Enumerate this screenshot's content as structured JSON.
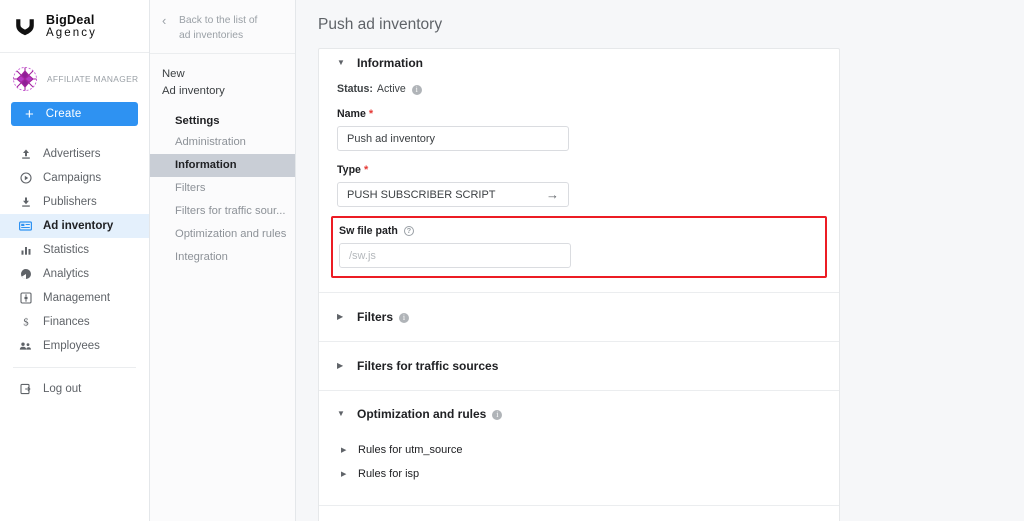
{
  "brand": {
    "name_line1": "BigDeal",
    "name_line2": "Agency",
    "logo_icon": "shield-v-logo"
  },
  "account": {
    "label": "AFFILIATE MANAGER",
    "logo_icon": "affiliate-manager-snowflake-logo"
  },
  "create_button": {
    "label": "Create",
    "icon": "plus-icon",
    "color": "#2e92f2"
  },
  "sidebar": {
    "items": [
      {
        "label": "Advertisers",
        "icon": "upload-arrow-icon",
        "active": false
      },
      {
        "label": "Campaigns",
        "icon": "play-circle-icon",
        "active": false
      },
      {
        "label": "Publishers",
        "icon": "download-arrow-icon",
        "active": false
      },
      {
        "label": "Ad inventory",
        "icon": "ad-banner-icon",
        "active": true
      },
      {
        "label": "Statistics",
        "icon": "bar-chart-icon",
        "active": false
      },
      {
        "label": "Analytics",
        "icon": "pie-chart-icon",
        "active": false
      },
      {
        "label": "Management",
        "icon": "settings-square-icon",
        "active": false
      },
      {
        "label": "Finances",
        "icon": "dollar-icon",
        "active": false
      },
      {
        "label": "Employees",
        "icon": "people-icon",
        "active": false
      }
    ],
    "logout": {
      "label": "Log out",
      "icon": "logout-icon"
    }
  },
  "panel2": {
    "back_link": {
      "line1": "Back to the list of",
      "line2": "ad inventories",
      "icon": "chevron-left-icon"
    },
    "title_line1": "New",
    "title_line2": "Ad inventory",
    "settings_heading": "Settings",
    "items": [
      {
        "label": "Administration",
        "active": false
      },
      {
        "label": "Information",
        "active": true
      },
      {
        "label": "Filters",
        "active": false
      },
      {
        "label": "Filters for traffic sour...",
        "active": false
      },
      {
        "label": "Optimization and rules",
        "active": false
      },
      {
        "label": "Integration",
        "active": false
      }
    ]
  },
  "main": {
    "page_title": "Push ad inventory",
    "information": {
      "section_title": "Information",
      "expanded": true,
      "status_key": "Status:",
      "status_value": "Active",
      "name_label": "Name",
      "name_value": "Push ad inventory",
      "type_label": "Type",
      "type_value": "PUSH SUBSCRIBER SCRIPT",
      "type_arrow_icon": "arrow-right-icon",
      "sw_label": "Sw file path",
      "sw_placeholder": "/sw.js",
      "sw_value": "",
      "highlight_color": "#ec1c24"
    },
    "filters": {
      "title": "Filters",
      "expanded": false
    },
    "filters_traffic": {
      "title": "Filters for traffic sources",
      "expanded": false
    },
    "optimization": {
      "title": "Optimization and rules",
      "expanded": true,
      "rules": [
        {
          "label": "Rules for utm_source"
        },
        {
          "label": "Rules for isp"
        }
      ]
    }
  }
}
